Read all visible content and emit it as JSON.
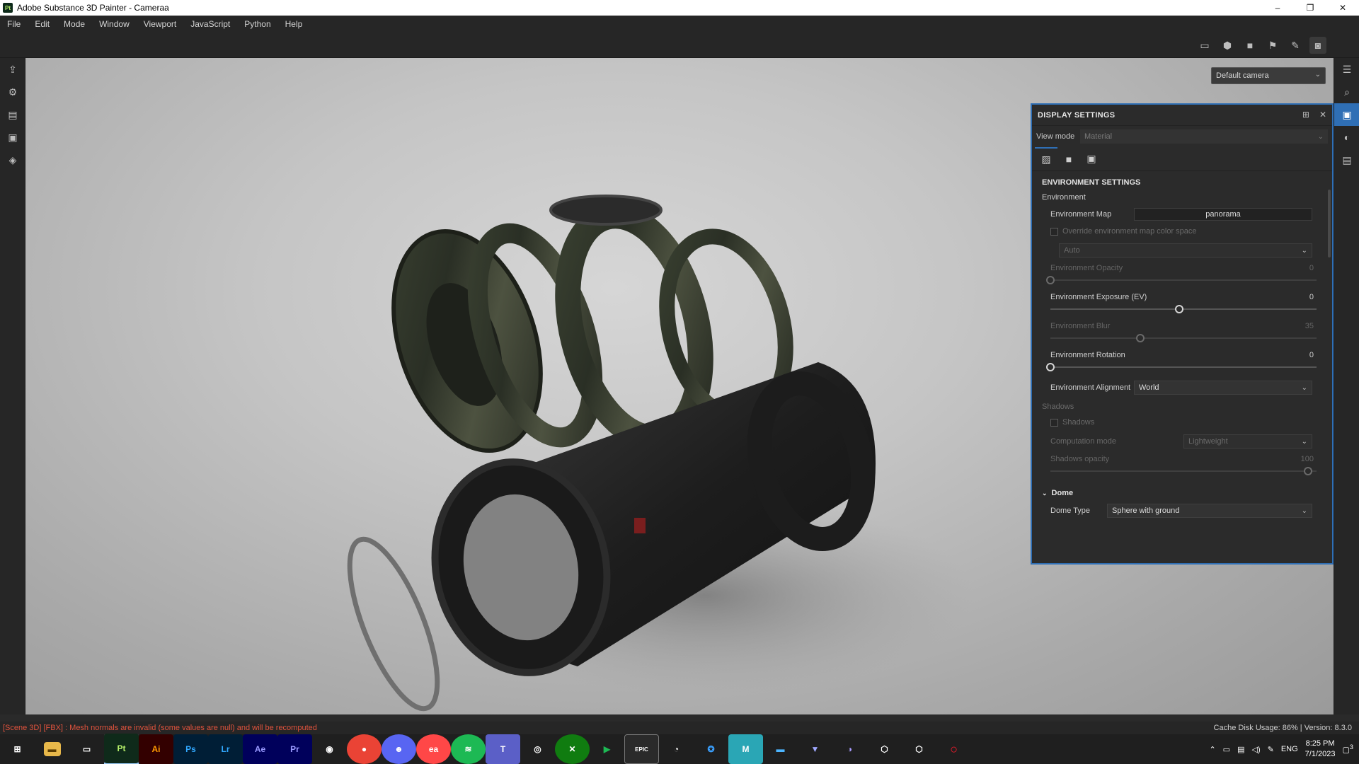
{
  "window": {
    "app_logo": "Pt",
    "title": "Adobe Substance 3D Painter - Cameraa",
    "minimize": "–",
    "restore": "❐",
    "close": "✕"
  },
  "menu": [
    "File",
    "Edit",
    "Mode",
    "Window",
    "Viewport",
    "JavaScript",
    "Python",
    "Help"
  ],
  "toolbar_icons": [
    "2d-view-icon",
    "3d-view-icon",
    "camera-icon",
    "rig-icon",
    "paint-icon",
    "screenshot-icon"
  ],
  "viewport": {
    "camera_select": "Default camera"
  },
  "panel": {
    "title": "DISPLAY SETTINGS",
    "view_mode_label": "View mode",
    "view_mode_value": "Material",
    "section_title": "ENVIRONMENT SETTINGS",
    "environment_group": "Environment",
    "env_map_label": "Environment Map",
    "env_map_value": "panorama",
    "override_label": "Override environment map color space",
    "colorspace_value": "Auto",
    "env_opacity_label": "Environment Opacity",
    "env_opacity_value": "0",
    "env_opacity_fraction": 0,
    "env_exposure_label": "Environment Exposure (EV)",
    "env_exposure_value": "0",
    "env_exposure_fraction": 0.5,
    "env_blur_label": "Environment Blur",
    "env_blur_value": "35",
    "env_blur_fraction": 0.35,
    "env_rotation_label": "Environment Rotation",
    "env_rotation_value": "0",
    "env_rotation_fraction": 0,
    "env_alignment_label": "Environment Alignment",
    "env_alignment_value": "World",
    "shadows_group": "Shadows",
    "shadows_checkbox": "Shadows",
    "computation_label": "Computation mode",
    "computation_value": "Lightweight",
    "shadows_opacity_label": "Shadows opacity",
    "shadows_opacity_value": "100",
    "shadows_opacity_fraction": 1,
    "dome_label": "Dome",
    "dome_type_label": "Dome Type",
    "dome_type_value": "Sphere with ground"
  },
  "status": {
    "error": "[Scene 3D] [FBX] : Mesh normals are invalid (some values are null) and will be recomputed",
    "cache": "Cache Disk Usage:   86% | Version: 8.3.0"
  },
  "taskbar": {
    "apps": [
      "Pt",
      "Ai",
      "Ps",
      "Lr",
      "Ae",
      "Pr"
    ],
    "tray_lang": "ENG",
    "time": "8:25 PM",
    "date": "7/1/2023",
    "notification_count": "3"
  }
}
